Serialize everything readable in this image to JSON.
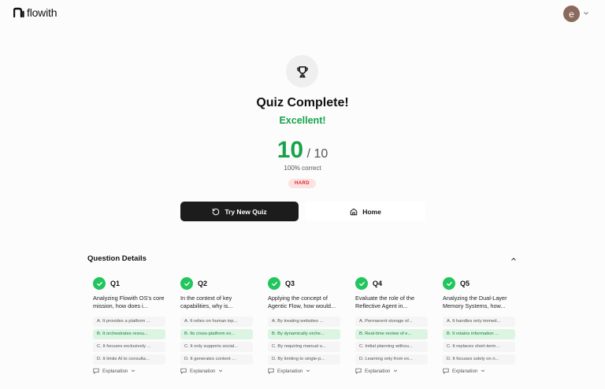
{
  "header": {
    "brand": "flowith",
    "avatar_initial": "e"
  },
  "result": {
    "title": "Quiz Complete!",
    "grade": "Excellent!",
    "score": "10",
    "total": "/ 10",
    "percent_text": "100% correct",
    "difficulty": "HARD"
  },
  "actions": {
    "try_new": "Try New Quiz",
    "home": "Home"
  },
  "details": {
    "title": "Question Details",
    "explanation_label": "Explanation",
    "questions": [
      {
        "num": "Q1",
        "text": "Analyzing Flowith OS's core mission, how does i...",
        "options": [
          "A. It provides a platform ...",
          "B. It orchestrates resou...",
          "C. It focuses exclusively ...",
          "D. It limits AI to consulta..."
        ]
      },
      {
        "num": "Q2",
        "text": "In the context of key capabilities, why is...",
        "options": [
          "A. It relies on human inp...",
          "B. Its cross-platform ex...",
          "C. It only supports social...",
          "D. It generates content ..."
        ]
      },
      {
        "num": "Q3",
        "text": "Applying the concept of Agentic Flow, how would...",
        "options": [
          "A. By treating websites ...",
          "B. By dynamically orche...",
          "C. By requiring manual u...",
          "D. By limiting to single-p..."
        ]
      },
      {
        "num": "Q4",
        "text": "Evaluate the role of the Reflective Agent in...",
        "options": [
          "A. Permanent storage of...",
          "B. Real-time review of e...",
          "C. Initial planning withou...",
          "D. Learning only from ex..."
        ]
      },
      {
        "num": "Q5",
        "text": "Analyzing the Dual-Layer Memory Systems, how...",
        "options": [
          "A. It handles only immed...",
          "B. It retains information ...",
          "C. It replaces short-term...",
          "D. It focuses solely on n..."
        ]
      }
    ]
  },
  "colors": {
    "accent_green": "#16a34a",
    "check_green": "#22c55e",
    "badge_red": "#dc2626",
    "dark_button": "#1c1c1c"
  }
}
